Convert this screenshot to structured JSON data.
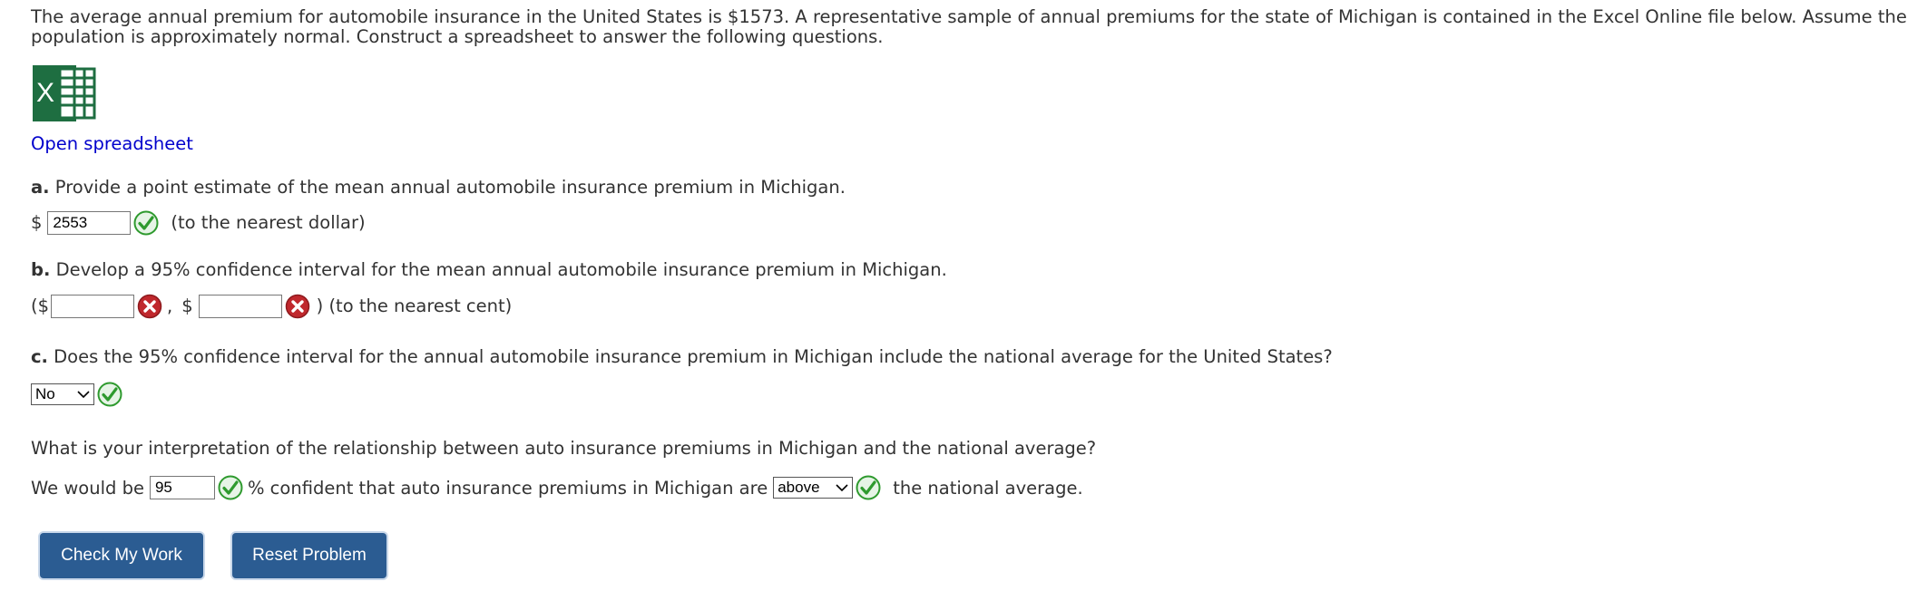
{
  "intro": "The average annual premium for automobile insurance in the United States is $1573. A representative sample of annual premiums for the state of Michigan is contained in the Excel Online file below. Assume the population is approximately normal. Construct a spreadsheet to answer the following questions.",
  "spreadsheet_link": "Open spreadsheet",
  "qa": {
    "label": "a.",
    "text": "Provide a point estimate of the mean annual automobile insurance premium in Michigan.",
    "currency": "$",
    "value": "2553",
    "hint": "(to the nearest dollar)"
  },
  "qb": {
    "label": "b.",
    "text": "Develop a 95% confidence interval for the mean annual automobile insurance premium in Michigan.",
    "open": "($",
    "sep": ",",
    "currency2": "$",
    "close": ") (to the nearest cent)",
    "lower_value": "",
    "upper_value": ""
  },
  "qc": {
    "label": "c.",
    "text": "Does the 95% confidence interval for the annual automobile insurance premium in Michigan include the national average for the United States?",
    "selected": "No"
  },
  "interp": {
    "question": "What is your interpretation of the relationship between auto insurance premiums in Michigan and the national average?",
    "prefix": "We would be",
    "confidence_value": "95",
    "middle": "% confident that auto insurance premiums in Michigan are",
    "selected": "above",
    "suffix": "the national average."
  },
  "buttons": {
    "check": "Check My Work",
    "reset": "Reset Problem"
  },
  "colors": {
    "link": "#0000cc",
    "button_bg": "#2b5c92",
    "correct": "#2e9a2e",
    "incorrect": "#c0282d",
    "excel_green": "#1e6e41"
  }
}
